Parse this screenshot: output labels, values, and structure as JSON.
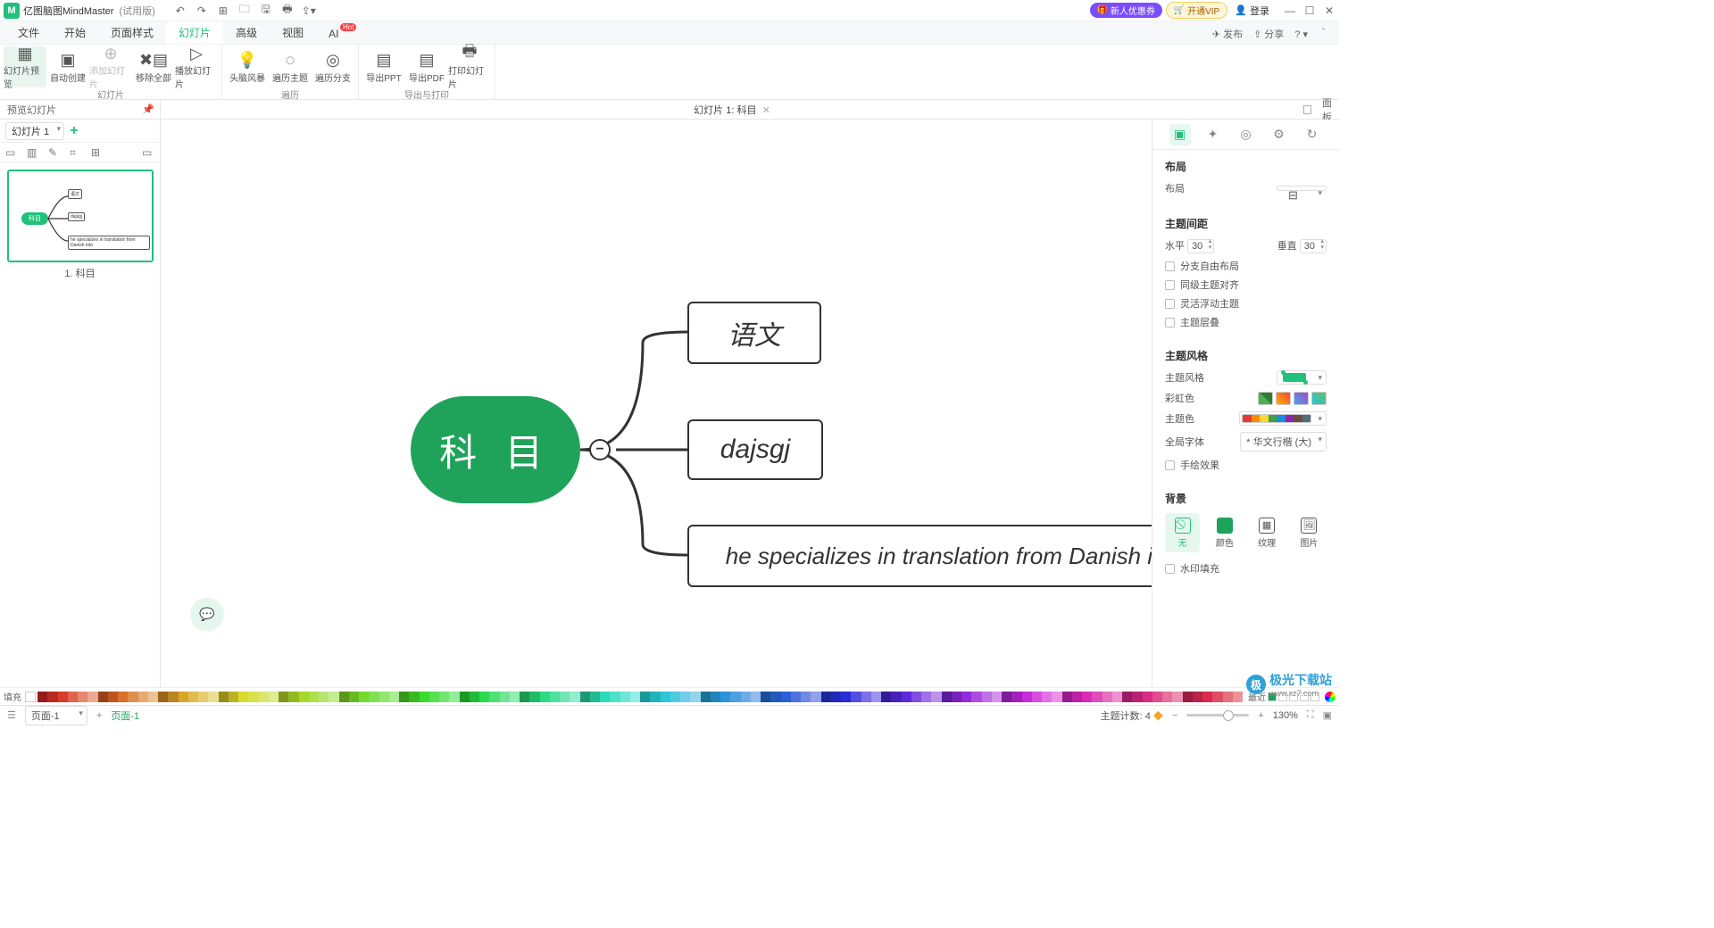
{
  "titlebar": {
    "app": "亿图脑图MindMaster",
    "trial": "(试用版)",
    "promo1": "新人优惠券",
    "promo2": "开通VIP",
    "login": "登录"
  },
  "menus": {
    "file": "文件",
    "start": "开始",
    "pagestyle": "页面样式",
    "slides": "幻灯片",
    "advanced": "高级",
    "view": "视图",
    "ai": "AI",
    "hot": "Hot",
    "publish": "发布",
    "share": "分享"
  },
  "ribbon": {
    "g1": {
      "btn1": "幻灯片预览",
      "btn2": "自动创建",
      "btn3": "添加幻灯片",
      "btn4": "移除全部",
      "btn5": "播放幻灯片",
      "label": "幻灯片"
    },
    "g2": {
      "btn1": "头脑风暴",
      "btn2": "遍历主题",
      "btn3": "遍历分支",
      "label": "遍历"
    },
    "g3": {
      "btn1": "导出PPT",
      "btn2": "导出PDF",
      "btn3": "打印幻灯片",
      "label": "导出与打印"
    }
  },
  "slidehdr": {
    "left": "预览幻灯片",
    "center": "幻灯片 1: 科目",
    "panel": "面板"
  },
  "leftpanel": {
    "selector": "幻灯片 1",
    "thumb_root": "科目",
    "thumb_c1": "语文",
    "thumb_c2": "dajsgj",
    "thumb_c3": "he specializes in translation from Danish into",
    "caption": "1. 科目"
  },
  "canvas": {
    "root": "科 目",
    "n1": "语文",
    "n2": "dajsgj",
    "n3": "he specializes in translation from Danish into"
  },
  "rightpanel": {
    "sect_layout": "布局",
    "layout_label": "布局",
    "sect_gap": "主题间距",
    "h_label": "水平",
    "h_val": "30",
    "v_label": "垂直",
    "v_val": "30",
    "chk1": "分支自由布局",
    "chk2": "同级主题对齐",
    "chk3": "灵活浮动主题",
    "chk4": "主题层叠",
    "sect_style": "主题风格",
    "style_label": "主题风格",
    "rainbow": "彩虹色",
    "themecolor": "主题色",
    "globalfont": "全局字体",
    "globalfont_val": "* 华文行楷 (大)",
    "handdraw": "手绘效果",
    "sect_bg": "背景",
    "bg_none": "无",
    "bg_color": "颜色",
    "bg_texture": "纹理",
    "bg_image": "图片",
    "watermarkfill": "水印填充"
  },
  "colorbar": {
    "fill": "填充",
    "recent": "最近"
  },
  "status": {
    "page_sel": "页面-1",
    "page_tab": "页面-1",
    "topics": "主题计数:",
    "topics_n": "4",
    "zminus": "−",
    "zplus": "+",
    "zoom": "130%"
  },
  "watermark": {
    "name": "极光下载站",
    "url": "www.xz7.com"
  }
}
